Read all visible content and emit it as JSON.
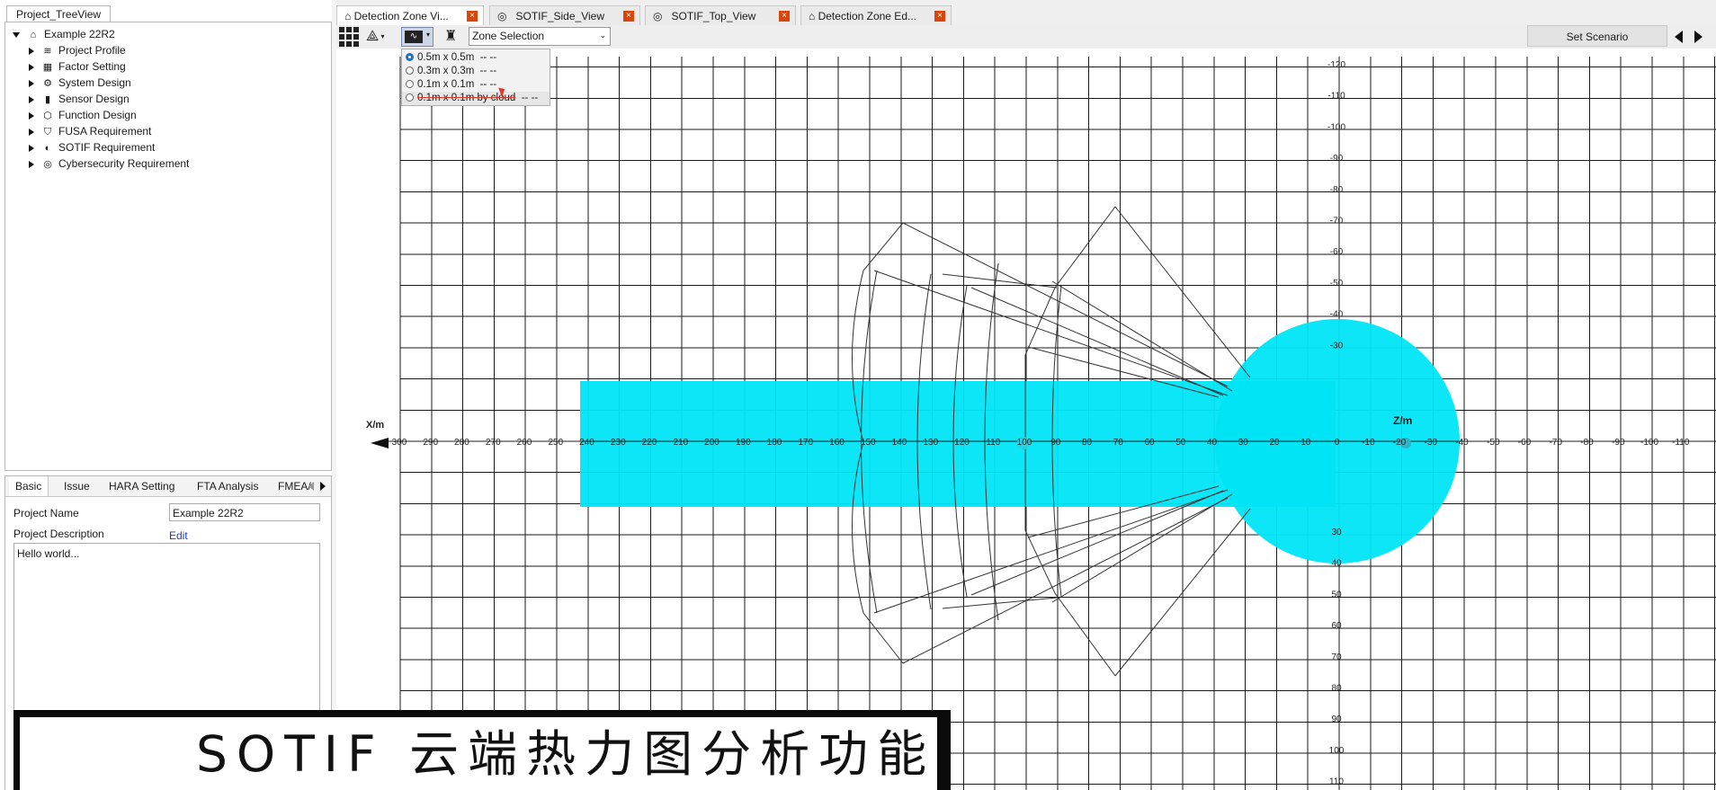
{
  "project_tree": {
    "tab_label": "Project_TreeView",
    "root": "Example 22R2",
    "items": [
      {
        "label": "Project Profile",
        "icon": "layers-icon"
      },
      {
        "label": "Factor Setting",
        "icon": "grid-icon"
      },
      {
        "label": "System Design",
        "icon": "system-icon"
      },
      {
        "label": "Sensor Design",
        "icon": "camera-icon"
      },
      {
        "label": "Function Design",
        "icon": "hexagon-icon"
      },
      {
        "label": "FUSA Requirement",
        "icon": "shield-icon"
      },
      {
        "label": "SOTIF Requirement",
        "icon": "half-circle-icon"
      },
      {
        "label": "Cybersecurity Requirement",
        "icon": "target-icon"
      }
    ]
  },
  "properties": {
    "tabs": [
      "Basic",
      "Issue",
      "HARA Setting",
      "FTA Analysis",
      "FMEA/"
    ],
    "project_name_label": "Project Name",
    "project_name_value": "Example 22R2",
    "project_description_label": "Project Description",
    "edit_link": "Edit",
    "description_text": "Hello world..."
  },
  "doc_tabs": [
    "Detection Zone Vi...",
    "SOTIF_Side_View",
    "SOTIF_Top_View",
    "Detection Zone Ed..."
  ],
  "toolbar": {
    "zone_selection": "Zone Selection",
    "set_scenario": "Set Scenario"
  },
  "grid_menu": {
    "items": [
      {
        "label": "0.5m x 0.5m",
        "suffix": "-- --",
        "selected": true
      },
      {
        "label": "0.3m x 0.3m",
        "suffix": "-- --",
        "selected": false
      },
      {
        "label": "0.1m x 0.1m",
        "suffix": "-- --",
        "selected": false
      },
      {
        "label": "0.1m x 0.1m by cloud",
        "suffix": "-- --",
        "selected": false
      }
    ]
  },
  "plot": {
    "x_axis_label": "X/m",
    "z_axis_label": "Z/m",
    "x_ticks": [
      "300",
      "290",
      "280",
      "270",
      "260",
      "250",
      "240",
      "230",
      "220",
      "210",
      "200",
      "190",
      "180",
      "170",
      "160",
      "150",
      "140",
      "130",
      "120",
      "110",
      "100",
      "90",
      "80",
      "70",
      "60",
      "50",
      "40",
      "30",
      "20",
      "10",
      "0",
      "-10",
      "-20",
      "-30",
      "-40",
      "-50",
      "-60",
      "-70",
      "-80",
      "-90",
      "-100",
      "-110"
    ],
    "z_ticks_up": [
      "-120",
      "-110",
      "-100",
      "-90",
      "-80",
      "-70",
      "-60",
      "-50",
      "-40",
      "-30"
    ],
    "z_ticks_down": [
      "30",
      "40",
      "50",
      "60",
      "70",
      "80",
      "90",
      "100",
      "110"
    ],
    "heat_color": "#00e5f5"
  },
  "caption": "SOTIF 云端热力图分析功能"
}
